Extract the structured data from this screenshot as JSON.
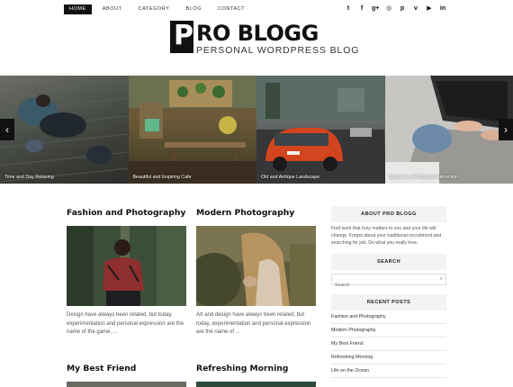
{
  "nav": {
    "items": [
      {
        "label": "HOME",
        "active": true
      },
      {
        "label": "ABOUT",
        "active": false
      },
      {
        "label": "CATEGORY",
        "active": false
      },
      {
        "label": "BLOG",
        "active": false
      },
      {
        "label": "CONTACT",
        "active": false
      }
    ]
  },
  "social": {
    "icons": [
      "twitter-icon",
      "facebook-icon",
      "google-plus-icon",
      "instagram-icon",
      "pinterest-icon",
      "vimeo-icon",
      "youtube-icon",
      "linkedin-icon"
    ],
    "glyphs": [
      "t",
      "f",
      "g+",
      "◎",
      "p",
      "v",
      "▶",
      "in"
    ]
  },
  "logo": {
    "letter": "P",
    "title": "RO BLOGG",
    "subtitle": "PERSONAL WORDPRESS BLOG"
  },
  "slider": {
    "prev_glyph": "‹",
    "next_glyph": "›",
    "slides": [
      {
        "caption": "Time and Day Relaxing"
      },
      {
        "caption": "Beautiful and Inspiring Cafe"
      },
      {
        "caption": "Old and Antique Landscape"
      },
      {
        "caption": "Business and Startup Interaction"
      }
    ]
  },
  "posts": [
    {
      "title": "Fashion and Photography",
      "excerpt": "Design have always been related, but today, experimentation and personal expression are the name of the game, ..."
    },
    {
      "title": "Modern Photography",
      "excerpt": "Art and design have always been related, but today, experimentation and personal expression are the name of ..."
    },
    {
      "title": "My Best Friend"
    },
    {
      "title": "Refreshing Morning"
    }
  ],
  "sidebar": {
    "about": {
      "heading": "ABOUT PRO BLOGG",
      "text": "Find work that truly matters to you and your life will change. Forget about your traditional recruitment and searching for job. Do what you really love."
    },
    "search": {
      "heading": "SEARCH",
      "placeholder": "Search"
    },
    "recent": {
      "heading": "RECENT POSTS",
      "items": [
        "Fashion and Photography",
        "Modern Photography",
        "My Best Friend",
        "Refreshing Morning",
        "Life on the Ocean"
      ]
    }
  },
  "colors": {
    "accent": "#111111",
    "widget_bg": "#f3f3f3"
  }
}
